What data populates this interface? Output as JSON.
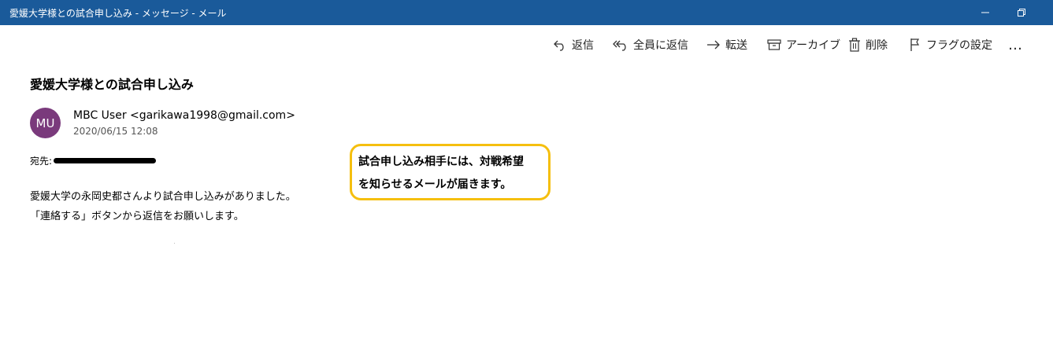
{
  "window": {
    "title": "愛媛大学様との試合申し込み - メッセージ - メール"
  },
  "toolbar": {
    "reply": "返信",
    "reply_all": "全員に返信",
    "forward": "転送",
    "archive": "アーカイブ",
    "delete": "削除",
    "flag": "フラグの設定",
    "more": "…"
  },
  "message": {
    "subject": "愛媛大学様との試合申し込み",
    "avatar_initials": "MU",
    "sender": "MBC User <garikawa1998@gmail.com>",
    "date": "2020/06/15 12:08",
    "to_label": "宛先:",
    "body_line1": "愛媛大学の永岡史都さんより試合申し込みがありました。",
    "body_line2": "「連絡する」ボタンから返信をお願いします。"
  },
  "callout": {
    "line1": "試合申し込み相手には、対戦希望",
    "line2": "を知らせるメールが届きます。"
  },
  "colors": {
    "titlebar": "#1a5a9a",
    "avatar": "#7a3a7c",
    "callout_border": "#f5bf0f"
  }
}
